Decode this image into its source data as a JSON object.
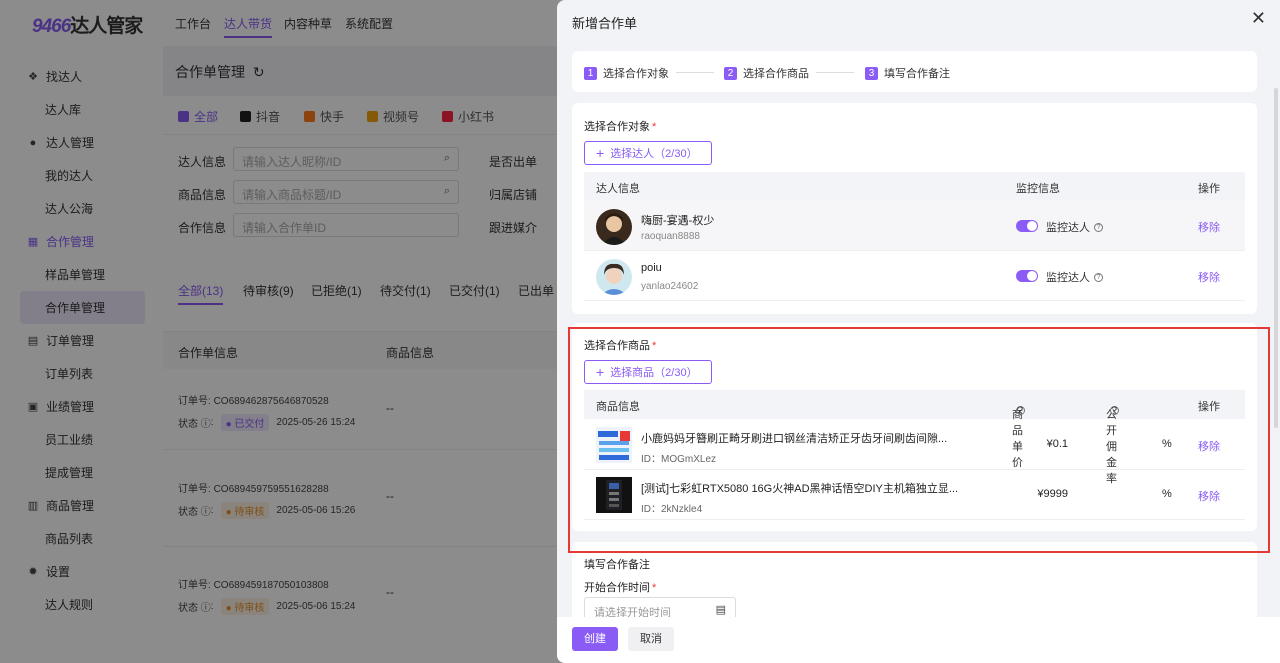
{
  "app": {
    "logo_num": "9466",
    "logo_text": "达人管家"
  },
  "sidebar": {
    "groups": [
      {
        "label": "找达人",
        "icon": "handshake-icon",
        "items": [
          "达人库"
        ]
      },
      {
        "label": "达人管理",
        "icon": "user-icon",
        "items": [
          "我的达人",
          "达人公海"
        ]
      },
      {
        "label": "合作管理",
        "icon": "grid-icon",
        "items": [
          "样品单管理",
          "合作单管理"
        ]
      },
      {
        "label": "订单管理",
        "icon": "order-icon",
        "items": [
          "订单列表"
        ]
      },
      {
        "label": "业绩管理",
        "icon": "chart-icon",
        "items": [
          "员工业绩",
          "提成管理"
        ]
      },
      {
        "label": "商品管理",
        "icon": "box-icon",
        "items": [
          "商品列表"
        ]
      },
      {
        "label": "设置",
        "icon": "gear-icon",
        "items": [
          "达人规则"
        ]
      }
    ]
  },
  "topnav": {
    "tabs": [
      "工作台",
      "达人带货",
      "内容种草",
      "系统配置"
    ],
    "active": 1
  },
  "main": {
    "title": "合作单管理",
    "platforms": [
      "全部",
      "抖音",
      "快手",
      "视频号",
      "小红书"
    ],
    "filters": [
      {
        "label": "达人信息",
        "placeholder": "请输入达人昵称/ID",
        "label2": "是否出单"
      },
      {
        "label": "商品信息",
        "placeholder": "请输入商品标题/ID",
        "label2": "归属店铺"
      },
      {
        "label": "合作信息",
        "placeholder": "请输入合作单ID",
        "label2": "跟进媒介"
      }
    ],
    "status_tabs": [
      "全部(13)",
      "待审核(9)",
      "已拒绝(1)",
      "待交付(1)",
      "已交付(1)",
      "已出单"
    ],
    "table_headers": [
      "合作单信息",
      "商品信息"
    ],
    "orders": [
      {
        "no_label": "订单号:",
        "no": "CO689462875646870528",
        "status_label": "状态",
        "status": "已交付",
        "time": "2025-05-26 15:24",
        "goods": "--"
      },
      {
        "no_label": "订单号:",
        "no": "CO689459759551628288",
        "status_label": "状态",
        "status": "待审核",
        "time": "2025-05-06 15:26",
        "goods": "--"
      },
      {
        "no_label": "订单号:",
        "no": "CO689459187050103808",
        "status_label": "状态",
        "status": "待审核",
        "time": "2025-05-06 15:24",
        "goods": "--"
      }
    ]
  },
  "drawer": {
    "title": "新增合作单",
    "steps": [
      "选择合作对象",
      "选择合作商品",
      "填写合作备注"
    ],
    "target_section": {
      "title": "选择合作对象",
      "add_label": "选择达人（2/30）",
      "headers": [
        "达人信息",
        "监控信息",
        "操作"
      ],
      "rows": [
        {
          "name": "嗨厨-宴遇-权少",
          "id": "raoquan8888",
          "monitor": "监控达人",
          "action": "移除"
        },
        {
          "name": "poiu",
          "id": "yanlao24602",
          "monitor": "监控达人",
          "action": "移除"
        }
      ]
    },
    "goods_section": {
      "title": "选择合作商品",
      "add_label": "选择商品（2/30）",
      "headers": [
        "商品信息",
        "商品单价",
        "公开佣金率",
        "操作"
      ],
      "rows": [
        {
          "name": "小鹿妈妈牙簪刷正畸牙刷进口钢丝清洁矫正牙齿牙间刷齿间隙...",
          "id": "ID：MOGmXLez",
          "price": "¥0.1",
          "rate": "%",
          "action": "移除"
        },
        {
          "name": "[测试]七彩虹RTX5080 16G火神AD黑神话悟空DIY主机箱独立显...",
          "id": "ID：2kNzkle4",
          "price": "¥9999",
          "rate": "%",
          "action": "移除"
        }
      ]
    },
    "remark_section": {
      "title": "填写合作备注",
      "start_label": "开始合作时间",
      "start_placeholder": "请选择开始时间"
    },
    "footer": {
      "create": "创建",
      "cancel": "取消"
    }
  },
  "colors": {
    "accent": "#8a5cf5",
    "highlight_border": "#e53935"
  }
}
